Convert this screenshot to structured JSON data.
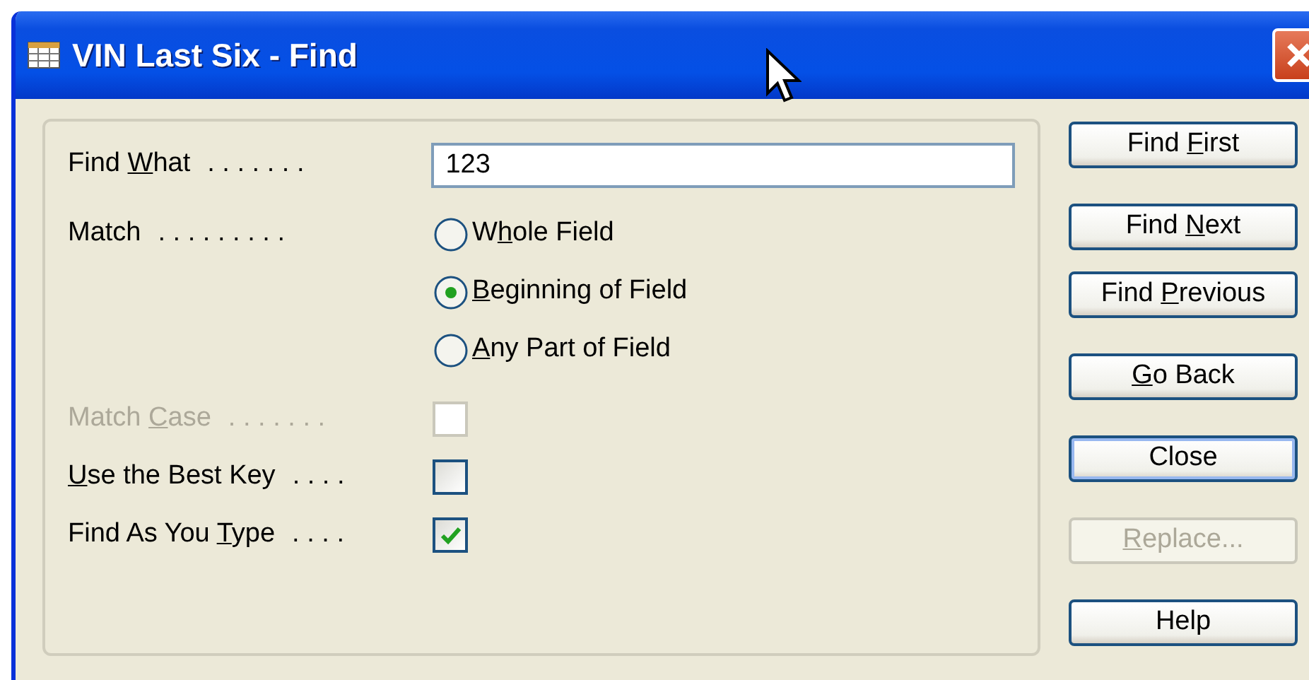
{
  "window": {
    "title": "VIN Last Six - Find"
  },
  "find_what": {
    "label": {
      "before": "Find ",
      "key": "W",
      "after": "hat"
    },
    "leader": ". . . . . . .",
    "value": "123"
  },
  "match": {
    "label": {
      "before": "Match"
    },
    "leader": ". . . . . . . . .",
    "options": [
      {
        "label": {
          "before": "W",
          "key": "h",
          "after": "ole Field"
        },
        "selected": false
      },
      {
        "label": {
          "key": "B",
          "after": "eginning of Field"
        },
        "selected": true
      },
      {
        "label": {
          "key": "A",
          "after": "ny Part of Field"
        },
        "selected": false
      }
    ]
  },
  "checkboxes": [
    {
      "label": {
        "before": "Match ",
        "key": "C",
        "after": "ase"
      },
      "leader": ". . . . . . .",
      "checked": false,
      "disabled": true
    },
    {
      "label": {
        "key": "U",
        "after": "se the Best Key"
      },
      "leader": ". . . .",
      "checked": false,
      "disabled": false
    },
    {
      "label": {
        "before": "Find As You ",
        "key": "T",
        "after": "ype"
      },
      "leader": ". . . .",
      "checked": true,
      "disabled": false
    }
  ],
  "buttons": [
    {
      "label": {
        "before": "Find ",
        "key": "F",
        "after": "irst"
      },
      "default": false,
      "disabled": false
    },
    {
      "label": {
        "before": "Find ",
        "key": "N",
        "after": "ext"
      },
      "default": false,
      "disabled": false
    },
    {
      "label": {
        "before": "Find ",
        "key": "P",
        "after": "revious"
      },
      "default": false,
      "disabled": false
    },
    {
      "label": {
        "key": "G",
        "after": "o Back"
      },
      "default": false,
      "disabled": false
    },
    {
      "label": {
        "before": "Close"
      },
      "default": true,
      "disabled": false
    },
    {
      "label": {
        "key": "R",
        "after": "eplace..."
      },
      "default": false,
      "disabled": true
    },
    {
      "label": {
        "before": "Help"
      },
      "default": false,
      "disabled": false
    }
  ]
}
